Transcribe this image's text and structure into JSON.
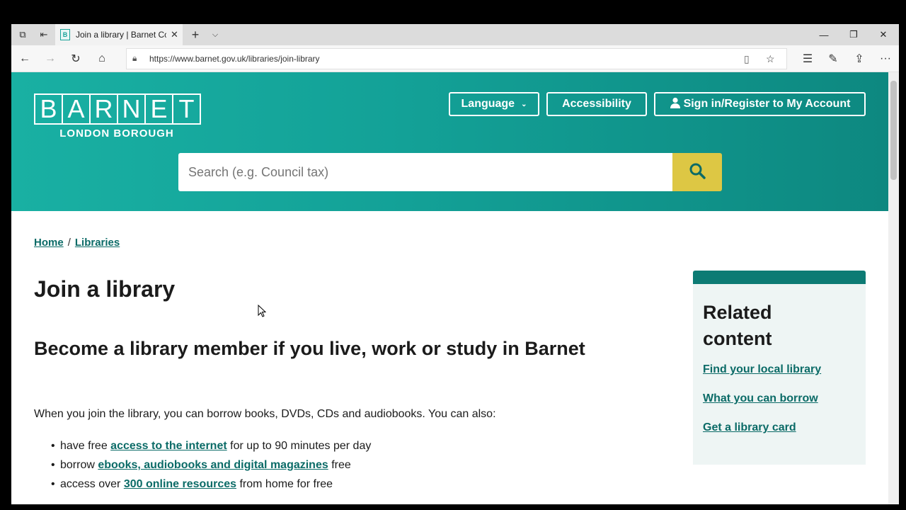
{
  "browser": {
    "tab_title": "Join a library | Barnet Cc",
    "favicon_letter": "B",
    "url": "https://www.barnet.gov.uk/libraries/join-library"
  },
  "header": {
    "logo_letters": [
      "B",
      "A",
      "R",
      "N",
      "E",
      "T"
    ],
    "logo_subtitle": "LONDON BOROUGH",
    "language_label": "Language",
    "accessibility_label": "Accessibility",
    "signin_label": "Sign in/Register to My Account",
    "search_placeholder": "Search (e.g. Council tax)"
  },
  "breadcrumb": {
    "home": "Home",
    "separator": "/",
    "libraries": "Libraries"
  },
  "main": {
    "title": "Join a library",
    "subtitle": "Become a library member if you live, work or study in Barnet",
    "intro": "When you join the library, you can borrow books, DVDs, CDs and audiobooks. You can also:",
    "bullets": [
      {
        "before": "have free",
        "link": "access to the internet",
        "after": "for up to 90 minutes per day"
      },
      {
        "before": "borrow",
        "link": "ebooks, audiobooks and digital magazines",
        "after": "free"
      },
      {
        "before": "access over",
        "link": "300 online resources",
        "after": "from home for free"
      }
    ]
  },
  "related": {
    "title": "Related content",
    "links": [
      "Find your local library",
      "What you can borrow",
      "Get a library card"
    ]
  },
  "colors": {
    "header_teal": "#13a197",
    "search_button": "#ddc744",
    "link": "#0b6b67"
  }
}
